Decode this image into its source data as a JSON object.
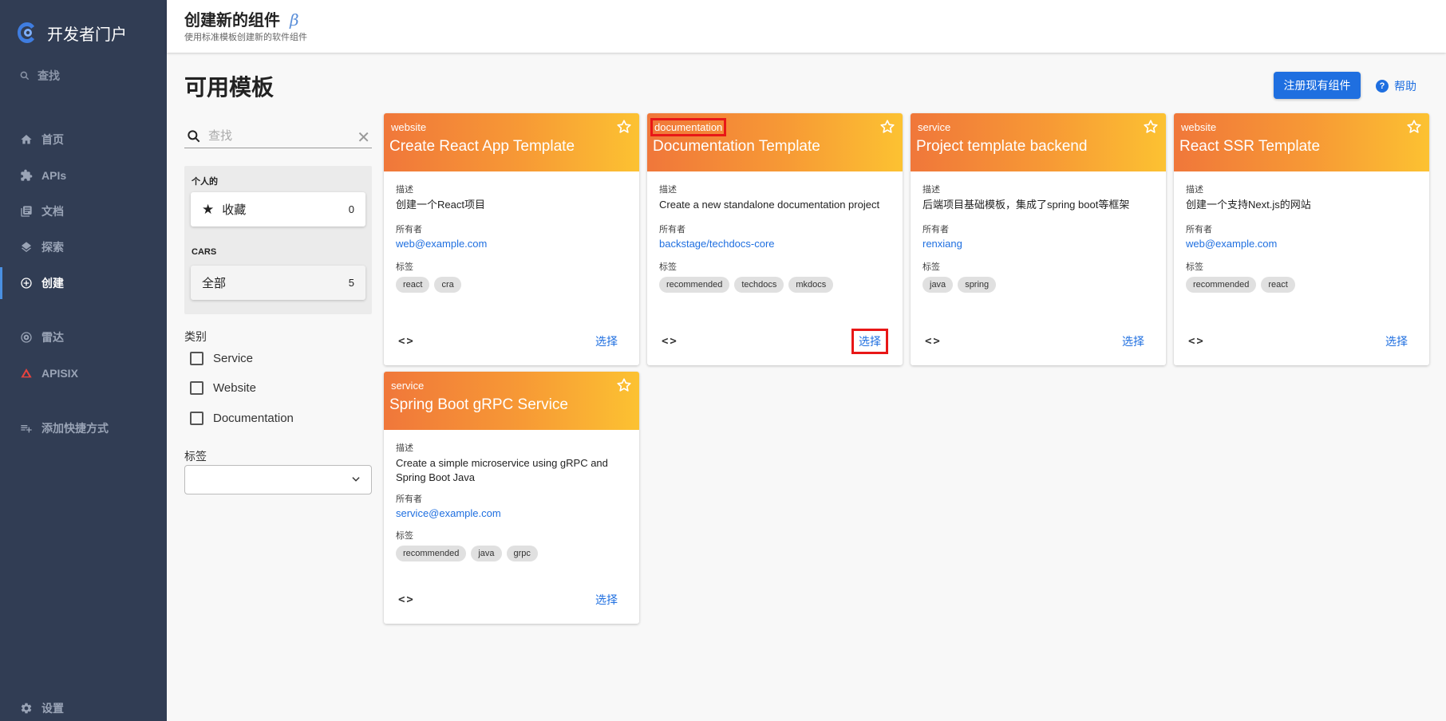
{
  "sidebar": {
    "brand": "开发者门户",
    "search_label": "查找",
    "items": [
      {
        "label": "首页",
        "icon": "home-icon"
      },
      {
        "label": "APIs",
        "icon": "puzzle-icon"
      },
      {
        "label": "文档",
        "icon": "library-icon"
      },
      {
        "label": "探索",
        "icon": "layers-icon"
      },
      {
        "label": "创建",
        "icon": "add-circle-icon"
      },
      {
        "label": "雷达",
        "icon": "radar-icon"
      },
      {
        "label": "APISIX",
        "icon": "apisix-icon"
      },
      {
        "label": "添加快捷方式",
        "icon": "add-shortcut-icon"
      },
      {
        "label": "设置",
        "icon": "gear-icon"
      }
    ]
  },
  "header": {
    "title": "创建新的组件",
    "beta": "β",
    "subtitle": "使用标准模板创建新的软件组件"
  },
  "main": {
    "title": "可用模板",
    "register_button": "注册现有组件",
    "help": "帮助"
  },
  "filters": {
    "search_placeholder": "查找",
    "personal_label": "个人的",
    "favorites_label": "收藏",
    "favorites_count": "0",
    "cars_label": "CARS",
    "all_label": "全部",
    "all_count": "5",
    "category_label": "类别",
    "categories": [
      "Service",
      "Website",
      "Documentation"
    ],
    "tags_label": "标签"
  },
  "labels": {
    "description": "描述",
    "owner": "所有者",
    "tags": "标签",
    "select": "选择"
  },
  "cards": [
    {
      "type": "website",
      "title": "Create React App Template",
      "description": "创建一个React项目",
      "owner": "web@example.com",
      "tags": [
        "react",
        "cra"
      ]
    },
    {
      "type": "documentation",
      "title": "Documentation Template",
      "description": "Create a new standalone documentation project",
      "owner": "backstage/techdocs-core",
      "tags": [
        "recommended",
        "techdocs",
        "mkdocs"
      ]
    },
    {
      "type": "service",
      "title": "Project template backend",
      "description": "后端项目基础模板，集成了spring boot等框架",
      "owner": "renxiang",
      "tags": [
        "java",
        "spring"
      ]
    },
    {
      "type": "website",
      "title": "React SSR Template",
      "description": "创建一个支持Next.js的网站",
      "owner": "web@example.com",
      "tags": [
        "recommended",
        "react"
      ]
    },
    {
      "type": "service",
      "title": "Spring Boot gRPC Service",
      "description": "Create a simple microservice using gRPC and Spring Boot Java",
      "owner": "service@example.com",
      "tags": [
        "recommended",
        "java",
        "grpc"
      ]
    }
  ]
}
